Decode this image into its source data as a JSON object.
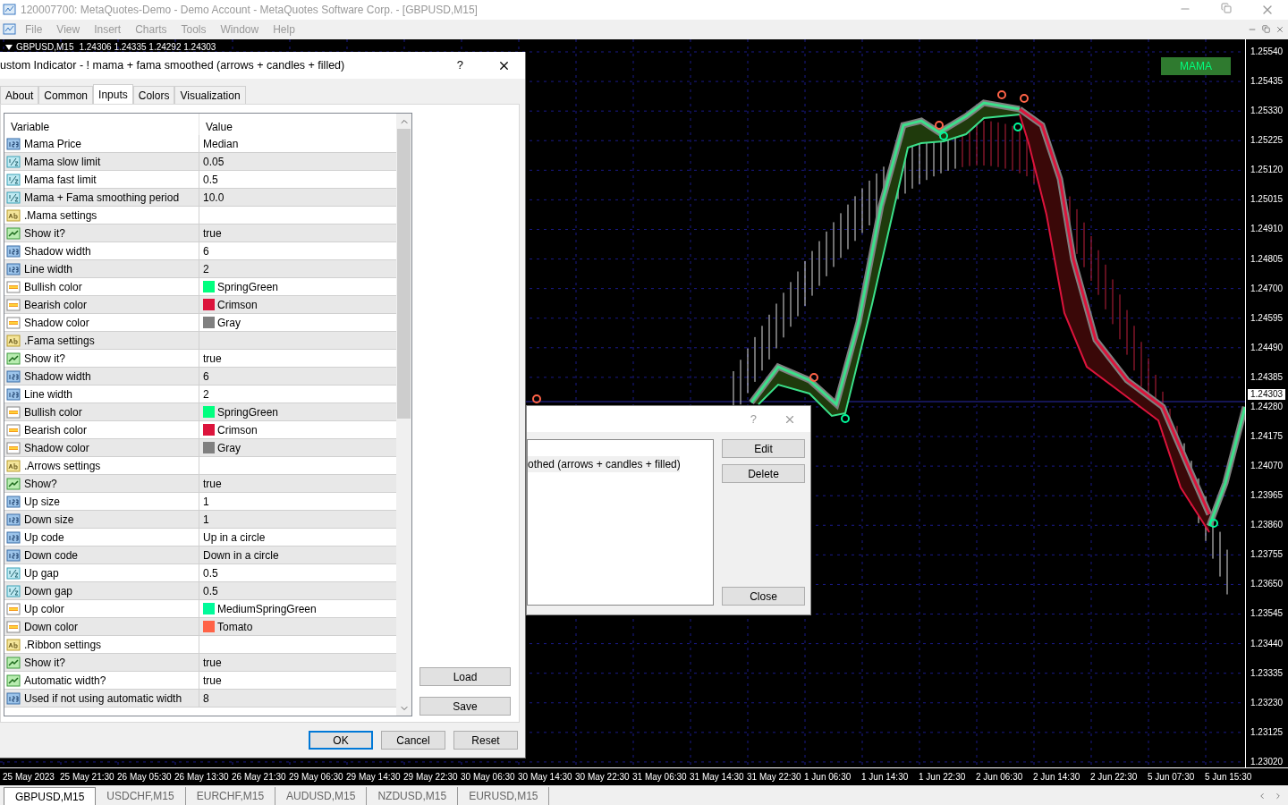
{
  "window": {
    "title": "120007700: MetaQuotes-Demo - Demo Account - MetaQuotes Software Corp. - [GBPUSD,M15]"
  },
  "menu": [
    "File",
    "View",
    "Insert",
    "Charts",
    "Tools",
    "Window",
    "Help"
  ],
  "chart": {
    "symbol": "GBPUSD,M15",
    "prices": "1.24306 1.24335 1.24292 1.24303",
    "legend": "MAMA",
    "current_price": "1.24303",
    "price_labels": [
      "1.25540",
      "1.25435",
      "1.25330",
      "1.25225",
      "1.25120",
      "1.25015",
      "1.24910",
      "1.24805",
      "1.24700",
      "1.24595",
      "1.24490",
      "1.24385",
      "1.24280",
      "1.24175",
      "1.24070",
      "1.23965",
      "1.23860",
      "1.23755",
      "1.23650",
      "1.23545",
      "1.23440",
      "1.23335",
      "1.23230",
      "1.23125",
      "1.23020"
    ],
    "time_labels": [
      "25 May 2023",
      "25 May 21:30",
      "26 May 05:30",
      "26 May 13:30",
      "26 May 21:30",
      "29 May 06:30",
      "29 May 14:30",
      "29 May 22:30",
      "30 May 06:30",
      "30 May 14:30",
      "30 May 22:30",
      "31 May 06:30",
      "31 May 14:30",
      "31 May 22:30",
      "1 Jun 06:30",
      "1 Jun 14:30",
      "1 Jun 22:30",
      "2 Jun 06:30",
      "2 Jun 14:30",
      "2 Jun 22:30",
      "5 Jun 07:30",
      "5 Jun 15:30"
    ]
  },
  "indicators_dialog": {
    "help": "?",
    "list_item": "othed (arrows + candles + filled)",
    "buttons": [
      "Edit",
      "Delete"
    ],
    "close": "Close"
  },
  "indicator_dialog": {
    "title": "ustom Indicator - ! mama + fama smoothed (arrows + candles + filled)",
    "help": "?",
    "tabs": [
      {
        "label": "About",
        "selected": false
      },
      {
        "label": "Common",
        "selected": false
      },
      {
        "label": "Inputs",
        "selected": true
      },
      {
        "label": "Colors",
        "selected": false
      },
      {
        "label": "Visualization",
        "selected": false
      }
    ],
    "columns": [
      "Variable",
      "Value"
    ],
    "rows": [
      {
        "kind": "int",
        "variable": "Mama Price",
        "value": "Median"
      },
      {
        "kind": "double",
        "variable": "Mama slow limit",
        "value": "0.05"
      },
      {
        "kind": "double",
        "variable": "Mama fast limit",
        "value": "0.5"
      },
      {
        "kind": "double",
        "variable": "Mama + Fama smoothing period",
        "value": "10.0"
      },
      {
        "kind": "string",
        "variable": ".Mama settings"
      },
      {
        "kind": "bool",
        "variable": "Show it?",
        "value": "true"
      },
      {
        "kind": "int",
        "variable": "Shadow width",
        "value": "6"
      },
      {
        "kind": "int",
        "variable": "Line width",
        "value": "2"
      },
      {
        "kind": "color",
        "variable": "Bullish color",
        "value": "SpringGreen",
        "color": "#00ff7f"
      },
      {
        "kind": "color",
        "variable": "Bearish color",
        "value": "Crimson",
        "color": "#dc143c"
      },
      {
        "kind": "color",
        "variable": "Shadow color",
        "value": "Gray",
        "color": "#808080"
      },
      {
        "kind": "string",
        "variable": ".Fama settings"
      },
      {
        "kind": "bool",
        "variable": "Show it?",
        "value": "true"
      },
      {
        "kind": "int",
        "variable": "Shadow width",
        "value": "6"
      },
      {
        "kind": "int",
        "variable": "Line width",
        "value": "2"
      },
      {
        "kind": "color",
        "variable": "Bullish color",
        "value": "SpringGreen",
        "color": "#00ff7f"
      },
      {
        "kind": "color",
        "variable": "Bearish color",
        "value": "Crimson",
        "color": "#dc143c"
      },
      {
        "kind": "color",
        "variable": "Shadow color",
        "value": "Gray",
        "color": "#808080"
      },
      {
        "kind": "string",
        "variable": ".Arrows settings"
      },
      {
        "kind": "bool",
        "variable": "Show?",
        "value": "true"
      },
      {
        "kind": "int",
        "variable": "Up size",
        "value": "1"
      },
      {
        "kind": "int",
        "variable": "Down size",
        "value": "1"
      },
      {
        "kind": "int",
        "variable": "Up code",
        "value": "Up in a circle"
      },
      {
        "kind": "int",
        "variable": "Down code",
        "value": "Down in a circle"
      },
      {
        "kind": "double",
        "variable": "Up gap",
        "value": "0.5"
      },
      {
        "kind": "double",
        "variable": "Down gap",
        "value": "0.5"
      },
      {
        "kind": "color",
        "variable": "Up color",
        "value": "MediumSpringGreen",
        "color": "#00fa9a"
      },
      {
        "kind": "color",
        "variable": "Down color",
        "value": "Tomato",
        "color": "#ff6347"
      },
      {
        "kind": "string",
        "variable": ".Ribbon settings"
      },
      {
        "kind": "bool",
        "variable": "Show it?",
        "value": "true"
      },
      {
        "kind": "bool",
        "variable": "Automatic width?",
        "value": "true"
      },
      {
        "kind": "int",
        "variable": "Used if not using automatic width",
        "value": "8"
      }
    ],
    "side_buttons": [
      "Load",
      "Save"
    ],
    "buttons": [
      {
        "label": "OK",
        "default": true
      },
      {
        "label": "Cancel",
        "default": false
      },
      {
        "label": "Reset",
        "default": false
      }
    ]
  },
  "symbol_tabs": [
    {
      "label": "GBPUSD,M15",
      "selected": true
    },
    {
      "label": "USDCHF,M15",
      "selected": false
    },
    {
      "label": "EURCHF,M15",
      "selected": false
    },
    {
      "label": "AUDUSD,M15",
      "selected": false
    },
    {
      "label": "NZDUSD,M15",
      "selected": false
    },
    {
      "label": "EURUSD,M15",
      "selected": false
    }
  ]
}
